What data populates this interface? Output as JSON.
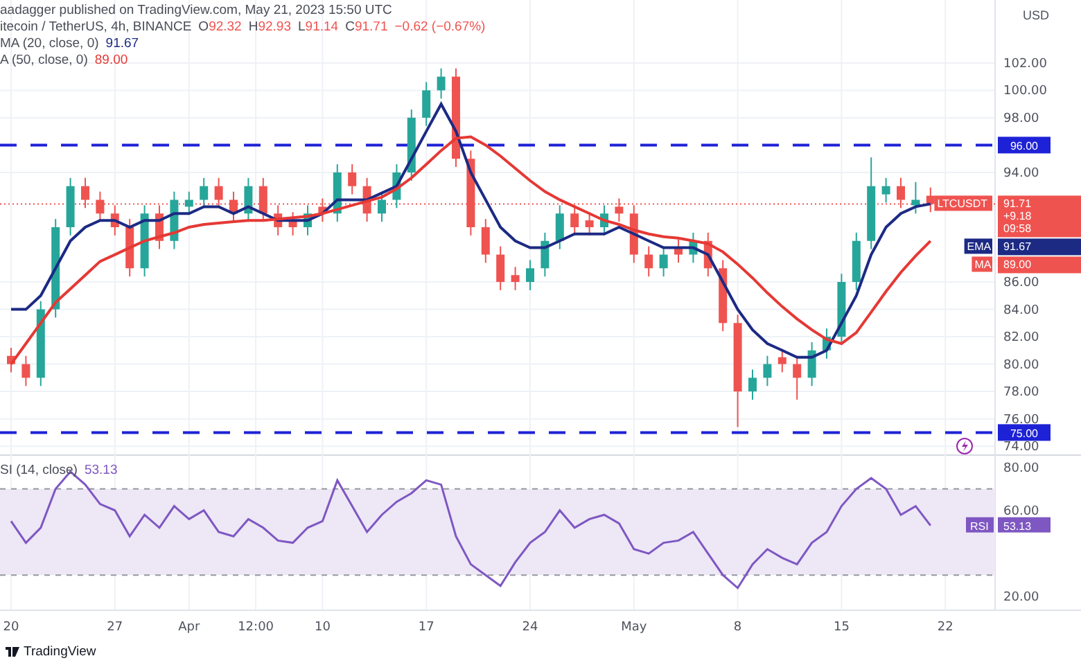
{
  "header": {
    "publisher_line": "aadagger published on TradingView.com, May 21, 2023 15:50 UTC",
    "symbol": "itecoin / TetherUS, 4h, BINANCE",
    "ohlc": [
      {
        "key": "O",
        "value": "92.32"
      },
      {
        "key": "H",
        "value": "92.93"
      },
      {
        "key": "L",
        "value": "91.14"
      },
      {
        "key": "C",
        "value": "91.71"
      }
    ],
    "change": "−0.62 (−0.67%)"
  },
  "indicators": [
    {
      "name": "MA (20, close, 0)",
      "value": "91.67",
      "color": "#1c2a84"
    },
    {
      "name": "A (50, close, 0)",
      "value": "89.00",
      "color": "#e53935"
    }
  ],
  "currency": "USD",
  "price_chart": {
    "chart_data": {
      "type": "candlestick",
      "grid": true,
      "ylim": [
        73.4,
        106.6
      ],
      "yticks": [
        {
          "value": 74,
          "label": "74.00"
        },
        {
          "value": 76,
          "label": "76.00"
        },
        {
          "value": 78,
          "label": "78.00"
        },
        {
          "value": 80,
          "label": "80.00"
        },
        {
          "value": 82,
          "label": "82.00"
        },
        {
          "value": 84,
          "label": "84.00"
        },
        {
          "value": 86,
          "label": "86.00"
        },
        {
          "value": 94,
          "label": "94.00"
        },
        {
          "value": 98,
          "label": "98.00"
        },
        {
          "value": 100,
          "label": "100.00"
        },
        {
          "value": 102,
          "label": "102.00"
        }
      ],
      "ohlc": [
        [
          80.6,
          81.2,
          79.4,
          80
        ],
        [
          80,
          80.6,
          78.4,
          79
        ],
        [
          79,
          84.6,
          78.4,
          84
        ],
        [
          84,
          90.6,
          83.4,
          90
        ],
        [
          90,
          93.6,
          89.4,
          93
        ],
        [
          93,
          93.6,
          91.4,
          92
        ],
        [
          92,
          92.6,
          90.4,
          91
        ],
        [
          91,
          91.6,
          89.4,
          90
        ],
        [
          90,
          90.6,
          86.4,
          87
        ],
        [
          87,
          91.6,
          86.4,
          91
        ],
        [
          91,
          91.6,
          88.4,
          89
        ],
        [
          89,
          92.6,
          88.4,
          92
        ],
        [
          91.5,
          92.6,
          90.9,
          92
        ],
        [
          92,
          93.6,
          91.4,
          93
        ],
        [
          93,
          93.6,
          91.4,
          92
        ],
        [
          92,
          92.6,
          90.4,
          91
        ],
        [
          91,
          93.6,
          90.4,
          93
        ],
        [
          93,
          93.6,
          90.4,
          91
        ],
        [
          91,
          91.6,
          89.4,
          90
        ],
        [
          90.5,
          91.1,
          89.4,
          90
        ],
        [
          90,
          91.6,
          89.4,
          91
        ],
        [
          91.5,
          92.1,
          90.4,
          91
        ],
        [
          91,
          94.6,
          90.4,
          94
        ],
        [
          94,
          94.6,
          92.4,
          93
        ],
        [
          93,
          93.6,
          90.4,
          91
        ],
        [
          91,
          92.6,
          90.4,
          92
        ],
        [
          92,
          94.6,
          91.4,
          94
        ],
        [
          94,
          98.6,
          93.4,
          98
        ],
        [
          98,
          100.6,
          97.4,
          100
        ],
        [
          100,
          101.6,
          99.4,
          101
        ],
        [
          101,
          101.6,
          94.4,
          95
        ],
        [
          95,
          95.6,
          89.4,
          90
        ],
        [
          90,
          90.6,
          87.4,
          88
        ],
        [
          88,
          88.6,
          85.4,
          86
        ],
        [
          86.5,
          87.1,
          85.4,
          86
        ],
        [
          86,
          87.6,
          85.4,
          87
        ],
        [
          87,
          89.6,
          86.4,
          89
        ],
        [
          89,
          91.6,
          88.4,
          91
        ],
        [
          91,
          91.6,
          89.4,
          90
        ],
        [
          90.5,
          91.1,
          89.4,
          90
        ],
        [
          90,
          91.6,
          89.4,
          91
        ],
        [
          91.5,
          92.1,
          90.4,
          91
        ],
        [
          91,
          91.6,
          87.4,
          88
        ],
        [
          88,
          88.6,
          86.4,
          87
        ],
        [
          87,
          88.6,
          86.4,
          88
        ],
        [
          88.5,
          89.1,
          87.4,
          88
        ],
        [
          88,
          89.6,
          87.4,
          89
        ],
        [
          89,
          89.6,
          86.4,
          87
        ],
        [
          87,
          87.6,
          82.4,
          83
        ],
        [
          83,
          83.6,
          75.4,
          78
        ],
        [
          78,
          79.6,
          77.4,
          79
        ],
        [
          79,
          80.6,
          78.4,
          80
        ],
        [
          80.5,
          81.1,
          79.4,
          80
        ],
        [
          80,
          80.6,
          77.4,
          79
        ],
        [
          79,
          81.6,
          78.4,
          81
        ],
        [
          81,
          82.6,
          80.4,
          82
        ],
        [
          82,
          86.6,
          81.4,
          86
        ],
        [
          86,
          89.6,
          85.4,
          89
        ],
        [
          89,
          95.1,
          88.4,
          93
        ],
        [
          92.4,
          93.6,
          91.8,
          93
        ],
        [
          93,
          93.6,
          91.4,
          92
        ],
        [
          91.6,
          93.3,
          91,
          92
        ],
        [
          92.3,
          92.9,
          91.1,
          91.7
        ]
      ],
      "series": [
        {
          "type": "line",
          "color": "#1c2a84",
          "values": [
            84,
            84,
            85,
            87,
            89,
            90,
            90.5,
            90.5,
            90,
            90.5,
            90.5,
            91,
            91,
            91.5,
            91.5,
            91,
            91.5,
            91,
            90.5,
            90.5,
            90.5,
            91,
            92,
            92,
            92,
            92.5,
            93,
            95,
            97,
            99,
            97,
            94,
            92,
            90,
            89,
            88.5,
            88.5,
            89,
            89.5,
            89.5,
            89.5,
            90,
            89.5,
            89,
            88.5,
            88.5,
            88.5,
            88,
            86,
            84,
            82.5,
            81.5,
            81,
            80.5,
            80.5,
            81,
            83,
            85,
            88,
            90,
            91,
            91.5,
            91.7
          ]
        },
        {
          "type": "line",
          "color": "#e53935",
          "values": [
            80,
            81.5,
            83,
            84.5,
            85.5,
            86.5,
            87.5,
            88,
            88.5,
            89,
            89.3,
            89.6,
            90,
            90.2,
            90.3,
            90.4,
            90.5,
            90.5,
            90.6,
            90.7,
            90.8,
            91,
            91.3,
            91.6,
            91.9,
            92.2,
            92.8,
            93.6,
            94.6,
            95.6,
            96.5,
            96.6,
            96,
            95.2,
            94.3,
            93.4,
            92.6,
            92,
            91.5,
            91,
            90.5,
            90.2,
            89.8,
            89.5,
            89.3,
            89.2,
            89,
            88.8,
            88.2,
            87.3,
            86.3,
            85.2,
            84.2,
            83.3,
            82.5,
            81.8,
            81.5,
            82.3,
            83.8,
            85.3,
            86.7,
            87.9,
            89
          ]
        }
      ],
      "ref_lines": [
        {
          "axis": "y",
          "value": 96,
          "label": "96.00"
        },
        {
          "axis": "y",
          "value": 75,
          "label": "75.00"
        },
        {
          "axis": "y",
          "value": 91.7
        }
      ]
    }
  },
  "price_labels": [
    {
      "tag": "LTCUSDT",
      "value": "91.71",
      "extra": [
        "+9.18",
        "09:58"
      ],
      "color": "#ef5350"
    },
    {
      "tag": "EMA",
      "value": "91.67",
      "color": "#1c2a84"
    },
    {
      "tag": "MA",
      "value": "89.00",
      "color": "#ef5350"
    }
  ],
  "rsi_legend": {
    "name": "SI (14, close)",
    "value": "53.13"
  },
  "rsi_chart": {
    "chart_data": {
      "type": "line",
      "grid": true,
      "ylim": [
        14,
        86
      ],
      "yticks": [
        {
          "value": 20,
          "label": "20.00"
        },
        {
          "value": 60,
          "label": "60.00"
        },
        {
          "value": 80,
          "label": "80.00"
        }
      ],
      "series": [
        {
          "color": "#7e57c2",
          "values": [
            55,
            45,
            52,
            70,
            78,
            72,
            63,
            60,
            48,
            58,
            52,
            62,
            56,
            60,
            50,
            48,
            56,
            52,
            46,
            45,
            52,
            55,
            74,
            62,
            50,
            58,
            64,
            68,
            74,
            72,
            48,
            35,
            30,
            25,
            36,
            45,
            50,
            60,
            52,
            56,
            58,
            54,
            42,
            40,
            45,
            46,
            50,
            40,
            30,
            24,
            35,
            42,
            38,
            35,
            45,
            50,
            62,
            70,
            75,
            70,
            58,
            62,
            53
          ]
        }
      ],
      "bands": [
        {
          "axis": "y",
          "from": 30,
          "to": 70
        }
      ],
      "ref_lines": [
        {
          "axis": "y",
          "value": 70
        },
        {
          "axis": "y",
          "value": 30
        }
      ]
    }
  },
  "rsi_label": {
    "tag": "RSI",
    "value": "53.13"
  },
  "date_axis": [
    "20",
    "27",
    "Apr",
    "12:00",
    "10",
    "17",
    "24",
    "May",
    "8",
    "15",
    "22"
  ],
  "footer": {
    "brand": "TradingView"
  }
}
